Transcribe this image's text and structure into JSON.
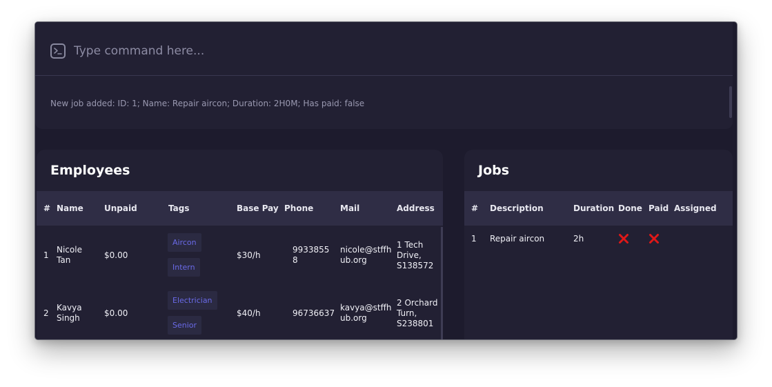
{
  "command": {
    "placeholder": "Type command here...",
    "result": "New job added: ID: 1; Name: Repair aircon; Duration: 2H0M; Has paid: false"
  },
  "employees": {
    "title": "Employees",
    "columns": [
      "#",
      "Name",
      "Unpaid",
      "Tags",
      "Base Pay",
      "Phone",
      "Mail",
      "Address"
    ],
    "rows": [
      {
        "index": "1",
        "name_line1": "Nicole",
        "name_line2": "Tan",
        "unpaid": "$0.00",
        "tags": [
          "Aircon",
          "Intern"
        ],
        "base_pay": "$30/h",
        "phone_line1": "9933855",
        "phone_line2": "8",
        "mail_line1": "nicole@stffh",
        "mail_line2": "ub.org",
        "address_line1": "1 Tech",
        "address_line2": "Drive,",
        "address_line3": "S138572"
      },
      {
        "index": "2",
        "name_line1": "Kavya",
        "name_line2": "Singh",
        "unpaid": "$0.00",
        "tags": [
          "Electrician",
          "Senior"
        ],
        "base_pay": "$40/h",
        "phone_line1": "96736637",
        "mail_line1": "kavya@stffh",
        "mail_line2": "ub.org",
        "address_line1": "2 Orchard",
        "address_line2": "Turn,",
        "address_line3": "S238801"
      }
    ]
  },
  "jobs": {
    "title": "Jobs",
    "columns": [
      "#",
      "Description",
      "Duration",
      "Done",
      "Paid",
      "Assigned"
    ],
    "rows": [
      {
        "index": "1",
        "description": "Repair aircon",
        "duration": "2h",
        "done": false,
        "paid": false,
        "assigned": ""
      }
    ]
  },
  "colors": {
    "background": "#1d1b2d",
    "panel": "#222033",
    "header": "#2f2d45",
    "tag_text": "#6a6ae8",
    "cross": "#e01818"
  }
}
